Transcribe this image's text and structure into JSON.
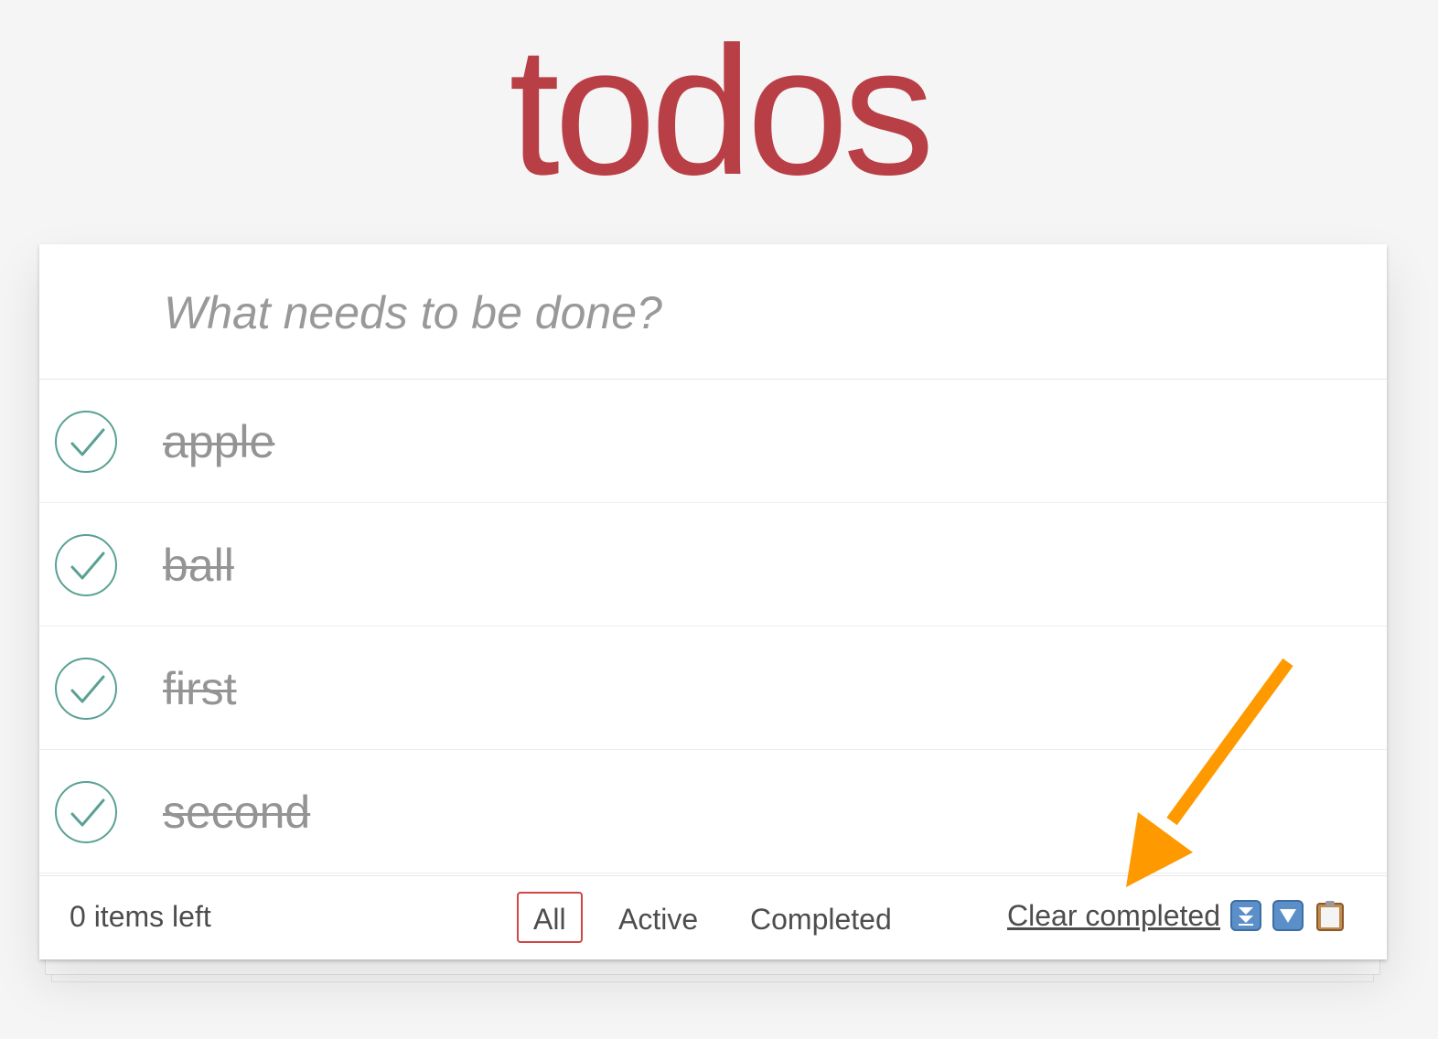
{
  "header": {
    "title": "todos"
  },
  "new_todo": {
    "placeholder": "What needs to be done?",
    "value": ""
  },
  "todos": [
    {
      "label": "apple",
      "completed": true
    },
    {
      "label": "ball",
      "completed": true
    },
    {
      "label": "first",
      "completed": true
    },
    {
      "label": "second",
      "completed": true
    }
  ],
  "footer": {
    "count_text": "0 items left",
    "filters": [
      {
        "label": "All",
        "selected": true
      },
      {
        "label": "Active",
        "selected": false
      },
      {
        "label": "Completed",
        "selected": false
      }
    ],
    "clear_completed_label": "Clear completed",
    "extension_icons": [
      "double-down-arrow-icon",
      "down-arrow-icon",
      "clipboard-icon"
    ]
  },
  "colors": {
    "title": "#b83f45",
    "check": "#59a193",
    "selected_filter_border": "#ce4646",
    "annotation_arrow": "#ff9900",
    "background": "#f5f5f5"
  }
}
